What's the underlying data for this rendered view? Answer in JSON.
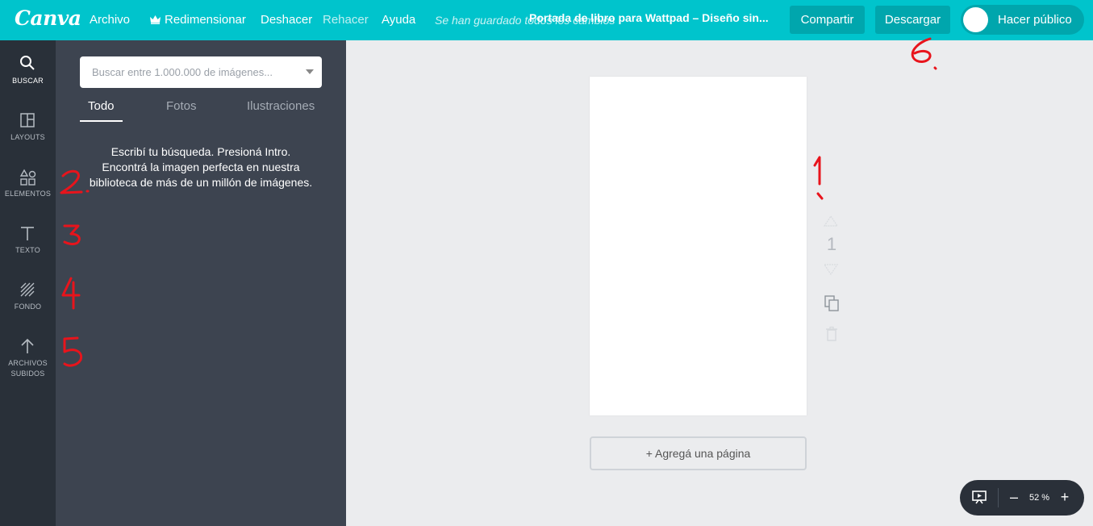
{
  "topbar": {
    "logo": "Canva",
    "menu": {
      "archivo": "Archivo",
      "redimensionar": "Redimensionar",
      "deshacer": "Deshacer",
      "rehacer": "Rehacer",
      "ayuda": "Ayuda"
    },
    "saved_status": "Se han guardado todos los cambios",
    "doc_title": "Portada de libro para Wattpad – Diseño sin...",
    "share_label": "Compartir",
    "download_label": "Descargar",
    "publish_label": "Hacer público",
    "bg_color": "#00c4cc"
  },
  "rail": {
    "buscar": "BUSCAR",
    "layouts": "LAYOUTS",
    "elementos": "ELEMENTOS",
    "texto": "TEXTO",
    "fondo": "FONDO",
    "archivos_1": "ARCHIVOS",
    "archivos_2": "SUBIDOS"
  },
  "panel": {
    "search_placeholder": "Buscar entre 1.000.000 de imágenes...",
    "tabs": {
      "todo": "Todo",
      "fotos": "Fotos",
      "ilustraciones": "Ilustraciones"
    },
    "empty_message": "Escribí tu búsqueda. Presioná Intro. Encontrá la imagen perfecta en nuestra biblioteca de más de un millón de imágenes."
  },
  "canvas": {
    "page_number": "1",
    "add_page_label": "+ Agregá una página",
    "zoom_level": "52 %",
    "zoom_minus": "–",
    "zoom_plus": "+"
  },
  "annotations": [
    "1",
    "2",
    "3",
    "4",
    "5",
    "6"
  ]
}
